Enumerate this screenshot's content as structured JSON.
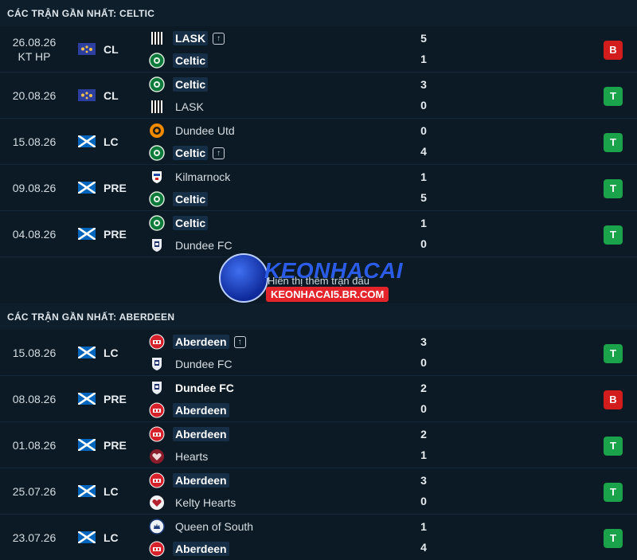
{
  "sections": [
    {
      "title": "CÁC TRẬN GẦN NHẤT: CELTIC",
      "matches": [
        {
          "date": "26.08.26",
          "note": "KT HP",
          "flag": "europe",
          "comp": "CL",
          "home": {
            "name": "LASK",
            "crest": "lask",
            "bold": true,
            "icon": "up"
          },
          "away": {
            "name": "Celtic",
            "crest": "celtic",
            "bold": true,
            "icon": ""
          },
          "home_score": "5",
          "away_score": "1",
          "result": "B"
        },
        {
          "date": "20.08.26",
          "note": "",
          "flag": "europe",
          "comp": "CL",
          "home": {
            "name": "Celtic",
            "crest": "celtic",
            "bold": true,
            "icon": ""
          },
          "away": {
            "name": "LASK",
            "crest": "lask",
            "bold": false,
            "icon": ""
          },
          "home_score": "3",
          "away_score": "0",
          "result": "T"
        },
        {
          "date": "15.08.26",
          "note": "",
          "flag": "scotland",
          "comp": "LC",
          "home": {
            "name": "Dundee Utd",
            "crest": "dundeeutd",
            "bold": false,
            "icon": ""
          },
          "away": {
            "name": "Celtic",
            "crest": "celtic",
            "bold": true,
            "icon": "up"
          },
          "home_score": "0",
          "away_score": "4",
          "result": "T"
        },
        {
          "date": "09.08.26",
          "note": "",
          "flag": "scotland",
          "comp": "PRE",
          "home": {
            "name": "Kilmarnock",
            "crest": "kilmarnock",
            "bold": false,
            "icon": ""
          },
          "away": {
            "name": "Celtic",
            "crest": "celtic",
            "bold": true,
            "icon": ""
          },
          "home_score": "1",
          "away_score": "5",
          "result": "T"
        },
        {
          "date": "04.08.26",
          "note": "",
          "flag": "scotland",
          "comp": "PRE",
          "home": {
            "name": "Celtic",
            "crest": "celtic",
            "bold": true,
            "icon": ""
          },
          "away": {
            "name": "Dundee FC",
            "crest": "dundeefc",
            "bold": false,
            "icon": ""
          },
          "home_score": "1",
          "away_score": "0",
          "result": "T"
        }
      ],
      "show_more": "Hiển thị thêm trận đấu"
    },
    {
      "title": "CÁC TRẬN GẦN NHẤT: ABERDEEN",
      "matches": [
        {
          "date": "15.08.26",
          "note": "",
          "flag": "scotland",
          "comp": "LC",
          "home": {
            "name": "Aberdeen",
            "crest": "aberdeen",
            "bold": true,
            "icon": "up"
          },
          "away": {
            "name": "Dundee FC",
            "crest": "dundeefc",
            "bold": false,
            "icon": ""
          },
          "home_score": "3",
          "away_score": "0",
          "result": "T"
        },
        {
          "date": "08.08.26",
          "note": "",
          "flag": "scotland",
          "comp": "PRE",
          "home": {
            "name": "Dundee FC",
            "crest": "dundeefc",
            "bold": true,
            "plain": true,
            "icon": ""
          },
          "away": {
            "name": "Aberdeen",
            "crest": "aberdeen",
            "bold": true,
            "icon": ""
          },
          "home_score": "2",
          "away_score": "0",
          "result": "B"
        },
        {
          "date": "01.08.26",
          "note": "",
          "flag": "scotland",
          "comp": "PRE",
          "home": {
            "name": "Aberdeen",
            "crest": "aberdeen",
            "bold": true,
            "icon": ""
          },
          "away": {
            "name": "Hearts",
            "crest": "hearts",
            "bold": false,
            "icon": ""
          },
          "home_score": "2",
          "away_score": "1",
          "result": "T"
        },
        {
          "date": "25.07.26",
          "note": "",
          "flag": "scotland",
          "comp": "LC",
          "home": {
            "name": "Aberdeen",
            "crest": "aberdeen",
            "bold": true,
            "icon": ""
          },
          "away": {
            "name": "Kelty Hearts",
            "crest": "kelty",
            "bold": false,
            "icon": ""
          },
          "home_score": "3",
          "away_score": "0",
          "result": "T"
        },
        {
          "date": "23.07.26",
          "note": "",
          "flag": "scotland",
          "comp": "LC",
          "home": {
            "name": "Queen of South",
            "crest": "queens",
            "bold": false,
            "icon": ""
          },
          "away": {
            "name": "Aberdeen",
            "crest": "aberdeen",
            "bold": true,
            "icon": ""
          },
          "home_score": "1",
          "away_score": "4",
          "result": "T"
        }
      ]
    }
  ],
  "watermark": {
    "brand": "KEONHACAI",
    "url": "KEONHACAI5.BR.COM"
  },
  "colors": {
    "win": "#1aa34a",
    "loss": "#d31d1d",
    "highlight": "#162f47"
  }
}
